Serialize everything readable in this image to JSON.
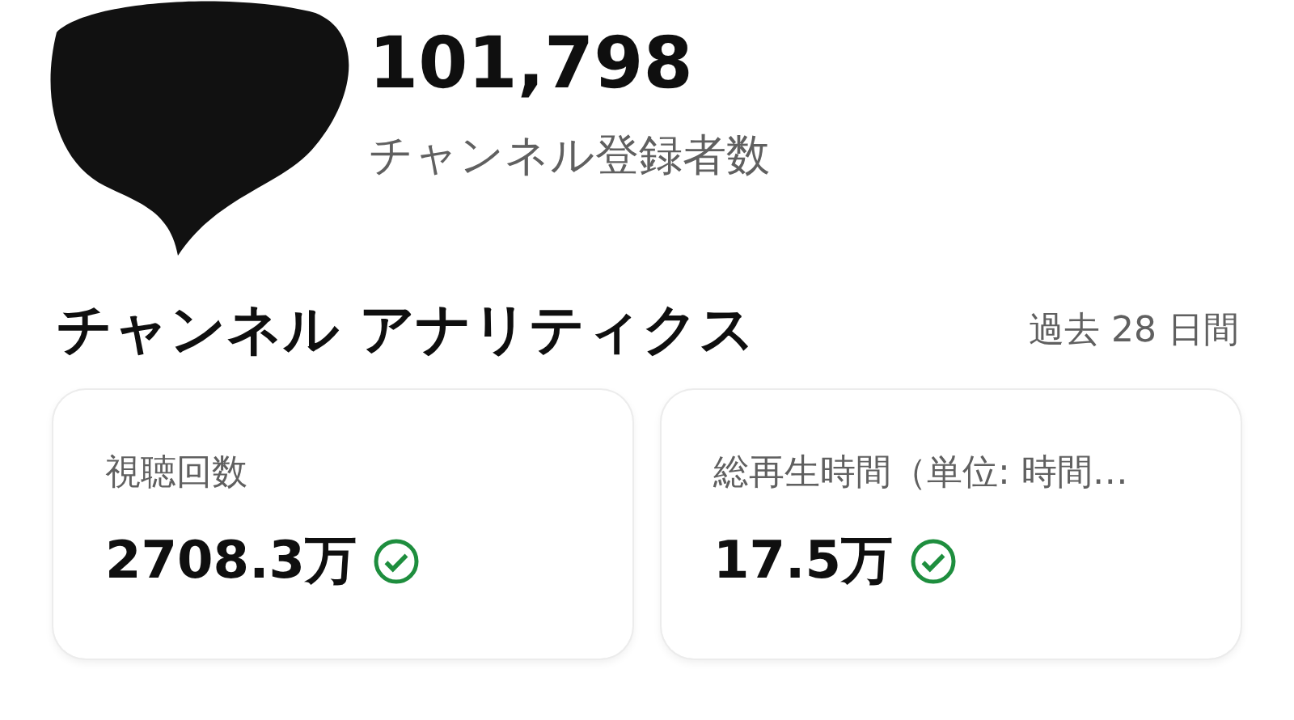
{
  "channel": {
    "subscriber_count": "101,798",
    "subscriber_label": "チャンネル登録者数"
  },
  "analytics": {
    "title": "チャンネル アナリティクス",
    "period": "過去 28 日間",
    "cards": [
      {
        "label": "視聴回数",
        "value": "2708.3万",
        "verified": true
      },
      {
        "label": "総再生時間（単位: 時間…",
        "value": "17.5万",
        "verified": true
      }
    ]
  }
}
